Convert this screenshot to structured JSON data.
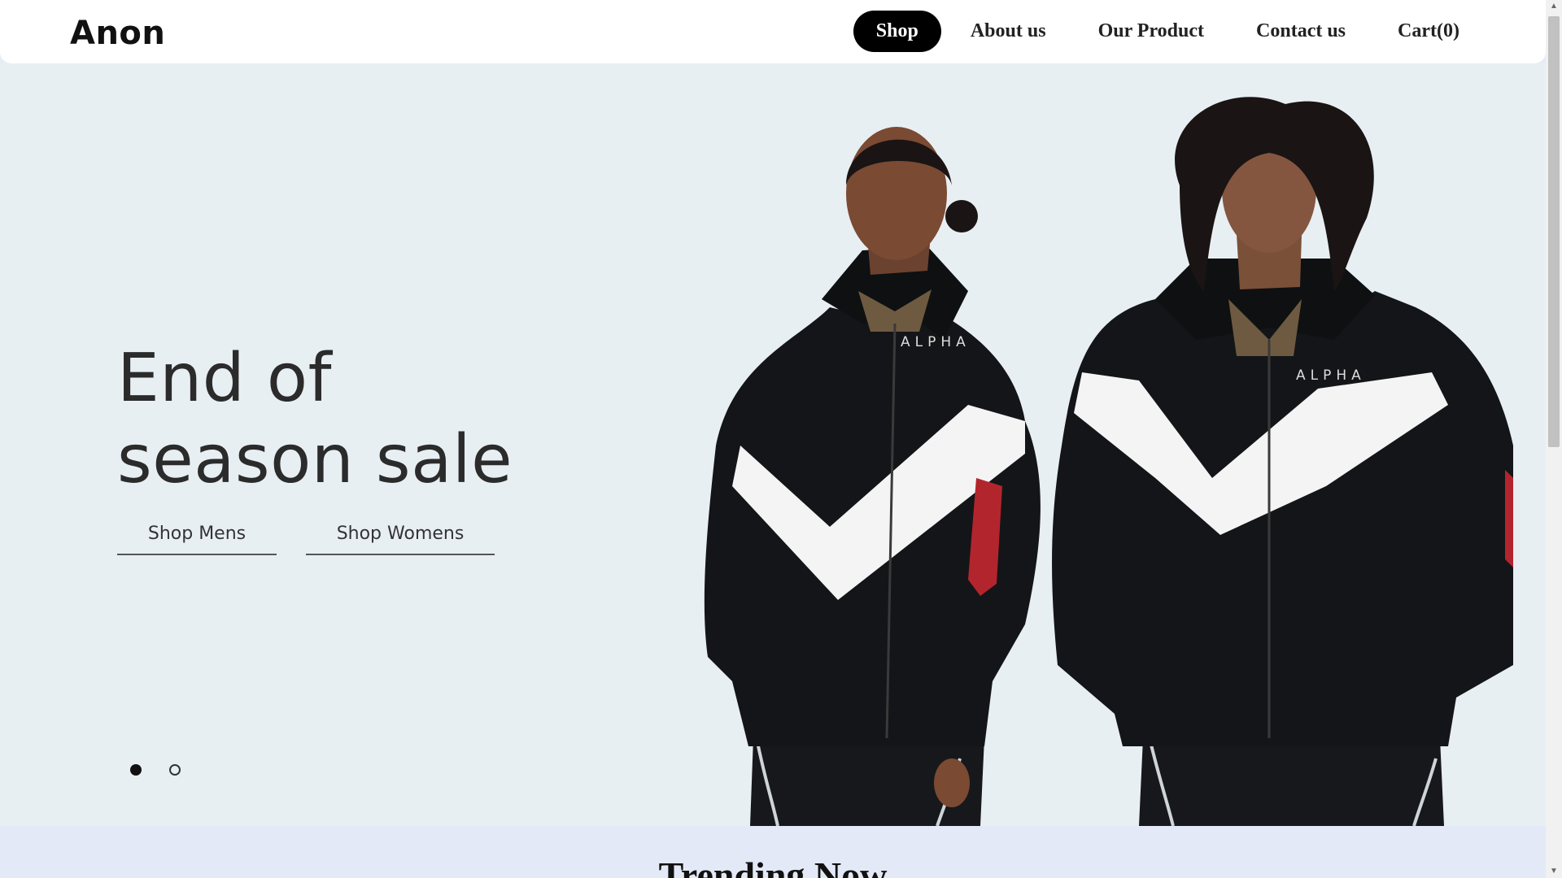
{
  "header": {
    "logo": "Anon",
    "nav": [
      {
        "label": "Shop",
        "active": true
      },
      {
        "label": "About us",
        "active": false
      },
      {
        "label": "Our Product",
        "active": false
      },
      {
        "label": "Contact us",
        "active": false
      },
      {
        "label": "Cart(0)",
        "active": false
      }
    ]
  },
  "hero": {
    "title_line1": "End of",
    "title_line2": "season sale",
    "shop_mens": "Shop Mens",
    "shop_womens": "Shop Womens",
    "slide_count": 2,
    "active_slide": 1,
    "brand_text": "ALPHA",
    "background_color": "#e8eff3"
  },
  "trending": {
    "title": "Trending Now"
  },
  "colors": {
    "accent": "#000000",
    "header_bg": "#ffffff",
    "trending_bg": "#e4e9f7"
  }
}
